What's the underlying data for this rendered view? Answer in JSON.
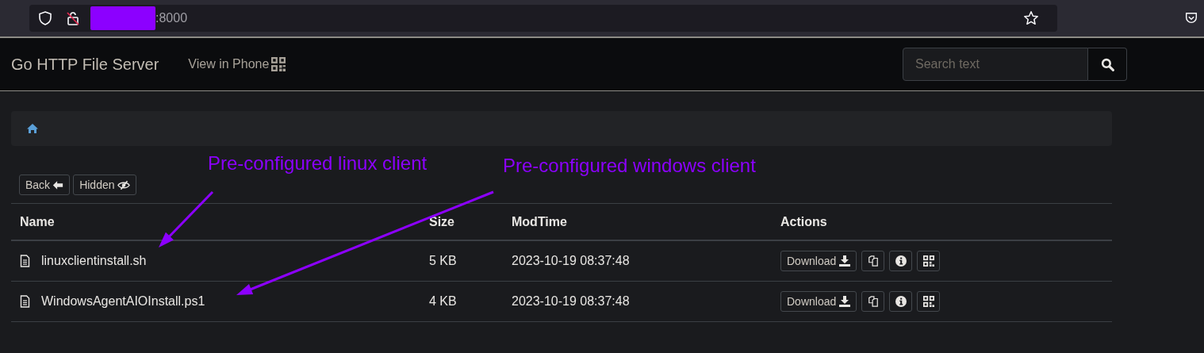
{
  "browser": {
    "url": ":8000"
  },
  "navbar": {
    "brand": "Go HTTP File Server",
    "phone_link": "View in Phone",
    "search": {
      "placeholder": "Search text"
    }
  },
  "toolbar": {
    "buttons": [
      {
        "label": "Back",
        "kind": "back"
      },
      {
        "label": "Hidden",
        "kind": "hidden"
      }
    ]
  },
  "table": {
    "columns": [
      "Name",
      "Size",
      "ModTime",
      "Actions"
    ],
    "rows": [
      {
        "name": "linuxclientinstall.sh",
        "size": "5 KB",
        "modtime": "2023-10-19 08:37:48",
        "download": "Download"
      },
      {
        "name": "WindowsAgentAIOInstall.ps1",
        "size": "4 KB",
        "modtime": "2023-10-19 08:37:48",
        "download": "Download"
      }
    ]
  },
  "annotations": [
    {
      "text": "Pre-configured linux client",
      "color": "#8c00ff"
    },
    {
      "text": "Pre-configured windows client",
      "color": "#8c00ff"
    }
  ]
}
